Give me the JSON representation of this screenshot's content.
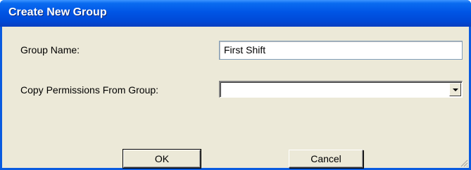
{
  "window": {
    "title": "Create New Group"
  },
  "form": {
    "group_name_label": "Group Name:",
    "group_name_value": "First Shift",
    "copy_permissions_label": "Copy Permissions From Group:",
    "copy_permissions_value": ""
  },
  "buttons": {
    "ok_label": "OK",
    "cancel_label": "Cancel"
  },
  "icons": {
    "dropdown": "chevron-down-icon",
    "resize": "resize-grip-icon"
  },
  "colors": {
    "titlebar": "#0055e5",
    "window_bg": "#ece9d8",
    "border": "#0a5be0"
  }
}
